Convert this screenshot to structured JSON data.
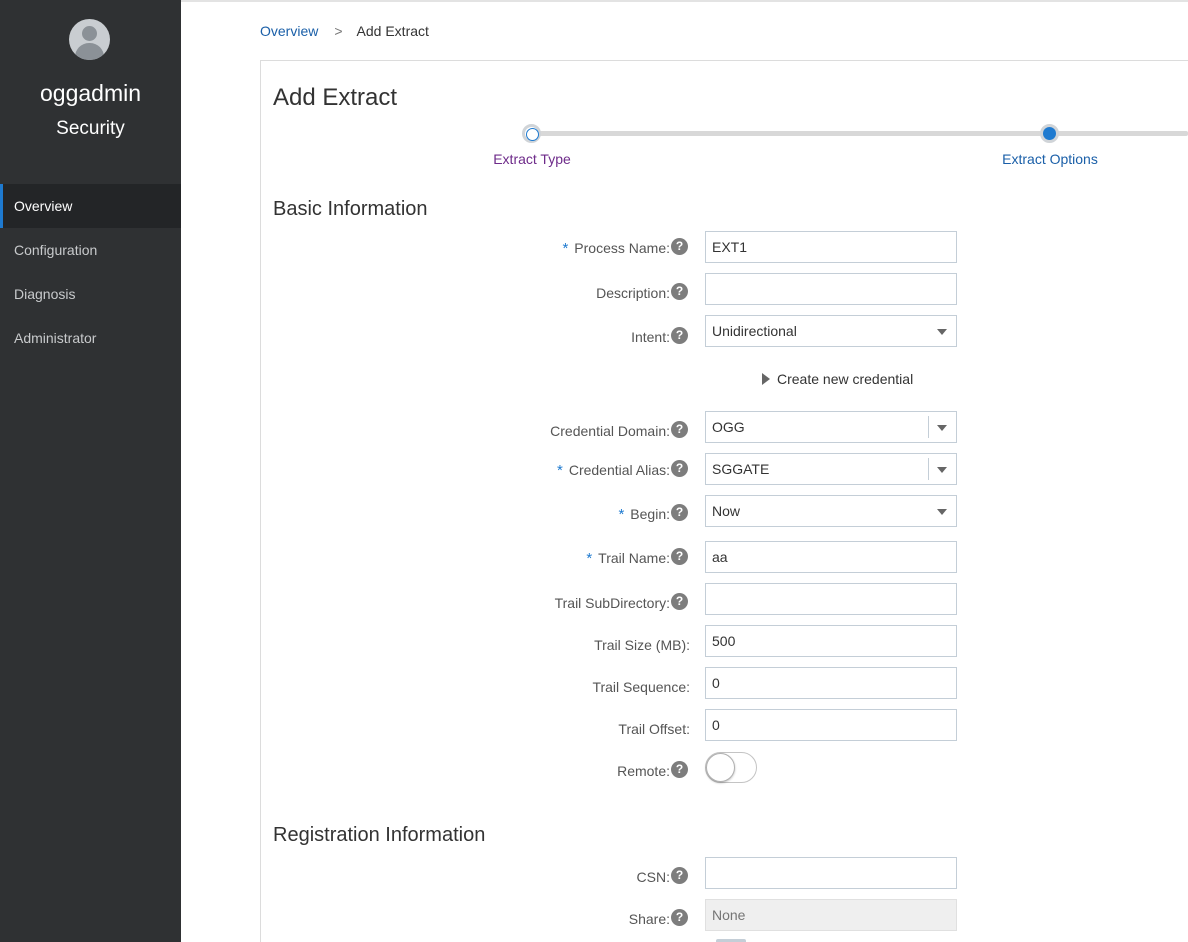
{
  "sidebar": {
    "username": "oggadmin",
    "deployment": "Security",
    "items": [
      {
        "label": "Overview",
        "active": true
      },
      {
        "label": "Configuration"
      },
      {
        "label": "Diagnosis"
      },
      {
        "label": "Administrator"
      }
    ]
  },
  "breadcrumb": {
    "parent": "Overview",
    "separator": ">",
    "current": "Add Extract"
  },
  "page": {
    "title": "Add Extract"
  },
  "train": {
    "steps": [
      {
        "label": "Extract Type",
        "state": "visited"
      },
      {
        "label": "Extract Options",
        "state": "current"
      }
    ]
  },
  "basic": {
    "title": "Basic Information",
    "process_name": {
      "label": "Process Name:",
      "value": "EXT1",
      "required": "*"
    },
    "description": {
      "label": "Description:",
      "value": ""
    },
    "intent": {
      "label": "Intent:",
      "value": "Unidirectional"
    },
    "create_credential": "Create new credential",
    "credential_domain": {
      "label": "Credential Domain:",
      "value": "OGG"
    },
    "credential_alias": {
      "label": "Credential Alias:",
      "value": "SGGATE",
      "required": "*"
    },
    "begin": {
      "label": "Begin:",
      "value": "Now",
      "required": "*"
    },
    "trail_name": {
      "label": "Trail Name:",
      "value": "aa",
      "required": "*"
    },
    "trail_subdirectory": {
      "label": "Trail SubDirectory:",
      "value": ""
    },
    "trail_size": {
      "label": "Trail Size (MB):",
      "value": "500"
    },
    "trail_sequence": {
      "label": "Trail Sequence:",
      "value": "0"
    },
    "trail_offset": {
      "label": "Trail Offset:",
      "value": "0"
    },
    "remote": {
      "label": "Remote:",
      "on": false
    }
  },
  "registration": {
    "title": "Registration Information",
    "csn": {
      "label": "CSN:",
      "value": ""
    },
    "share": {
      "label": "Share:",
      "placeholder": "None"
    }
  },
  "help_glyph": "?",
  "colors": {
    "sidebar_bg": "#2f3133",
    "accent": "#1e7ad0",
    "link": "#1a5fa8",
    "visited_step": "#6e2b8a"
  }
}
